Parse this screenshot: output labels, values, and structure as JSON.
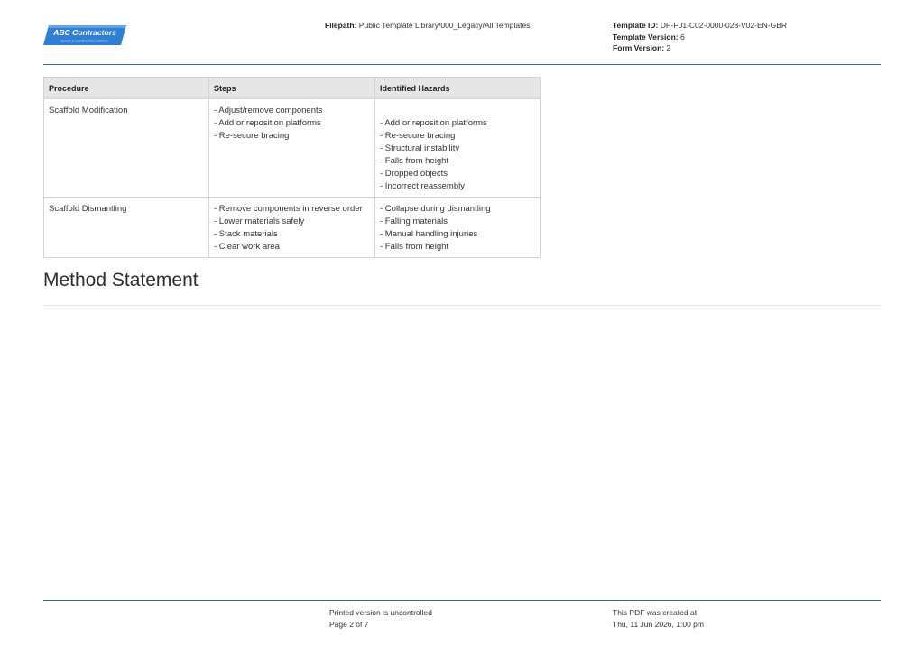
{
  "header": {
    "logo": {
      "main_text": "ABC Contractors",
      "sub_text": "EXAMPLE CONTRACTING COMPANY",
      "color": "#2f7fd6"
    },
    "filepath_label": "Filepath:",
    "filepath_value": "Public Template Library/000_Legacy/All Templates",
    "template_id_label": "Template ID:",
    "template_id_value": "DP-F01-C02-0000-028-V02-EN-GBR",
    "template_version_label": "Template Version:",
    "template_version_value": "6",
    "form_version_label": "Form Version:",
    "form_version_value": "2",
    "rule_color": "#2b6ea8"
  },
  "table": {
    "headers": [
      "Procedure",
      "Steps",
      "Identified Hazards"
    ],
    "rows": [
      {
        "procedure": "Scaffold Modification",
        "steps": [
          "- Adjust/remove components",
          "- Add or reposition platforms",
          "- Re-secure bracing"
        ],
        "hazards": [
          "",
          "- Add or reposition platforms",
          "- Re-secure bracing",
          "- Structural instability",
          "- Falls from height",
          "- Dropped objects",
          "- Incorrect reassembly"
        ]
      },
      {
        "procedure": "Scaffold Dismantling",
        "steps": [
          "- Remove components in reverse order",
          "- Lower materials safely",
          "- Stack materials",
          "- Clear work area"
        ],
        "hazards": [
          "- Collapse during dismantling",
          "- Falling materials",
          "- Manual handling injuries",
          "- Falls from height"
        ]
      }
    ]
  },
  "section": {
    "title": "Method Statement"
  },
  "footer": {
    "uncontrolled": "Printed version is uncontrolled",
    "page": "Page 2 of 7",
    "created_label": "This PDF was created at",
    "created_value": "Thu, 11 Jun 2026, 1:00 pm"
  }
}
